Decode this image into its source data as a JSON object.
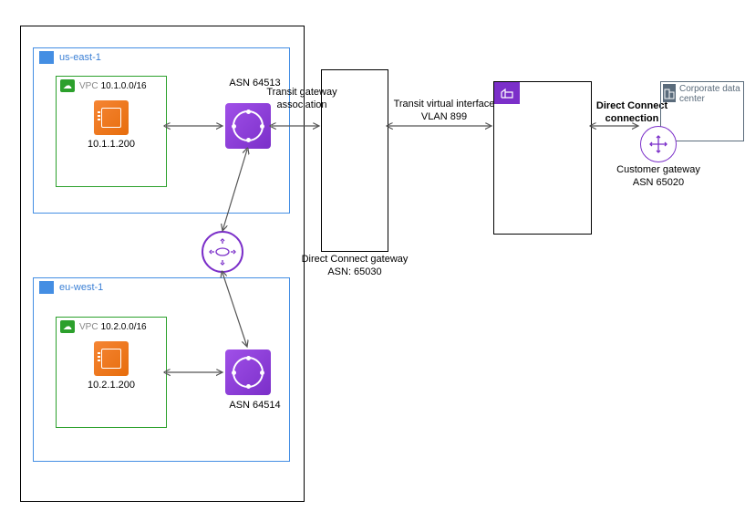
{
  "regions": {
    "us_east_1": {
      "name": "us-east-1",
      "asn": "ASN 64513",
      "vpc": {
        "label": "VPC",
        "cidr": "10.1.0.0/16",
        "instance_ip": "10.1.1.200"
      }
    },
    "eu_west_1": {
      "name": "eu-west-1",
      "asn": "ASN 64514",
      "vpc": {
        "label": "VPC",
        "cidr": "10.2.0.0/16",
        "instance_ip": "10.2.1.200"
      }
    }
  },
  "transit_gateway_association": "Transit gateway association",
  "direct_connect_gateway": {
    "name": "Direct Connect gateway",
    "asn": "ASN: 65030"
  },
  "transit_virtual_interface": {
    "name": "Transit virtual interface",
    "vlan": "VLAN 899"
  },
  "direct_connect_connection": "Direct Connect connection",
  "corporate_data_center": "Corporate data center",
  "customer_gateway": {
    "name": "Customer gateway",
    "asn": "ASN 65020"
  }
}
